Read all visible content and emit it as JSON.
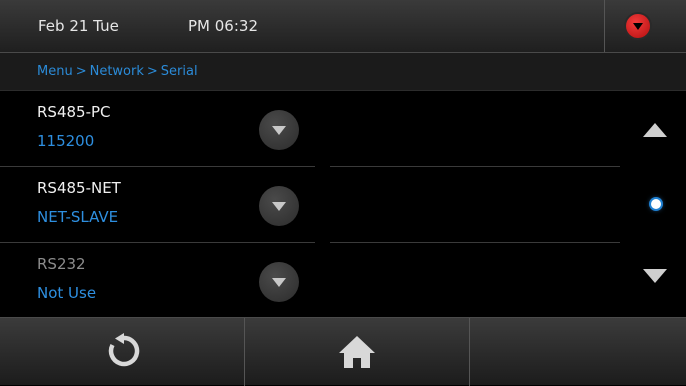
{
  "status_bar": {
    "date": "Feb 21 Tue",
    "time": "PM 06:32",
    "menu_icon": "red-dropdown-icon"
  },
  "breadcrumb": {
    "items": [
      "Menu",
      "Network",
      "Serial"
    ],
    "separator": ">"
  },
  "serial_list": [
    {
      "label": "RS485-PC",
      "value": "115200",
      "enabled": true
    },
    {
      "label": "RS485-NET",
      "value": "NET-SLAVE",
      "enabled": true
    },
    {
      "label": "RS232",
      "value": "Not Use",
      "enabled": false
    }
  ],
  "scroll": {
    "up_icon": "arrow-up-icon",
    "indicator": "scroll-position-dot",
    "down_icon": "arrow-down-icon"
  },
  "footer": {
    "buttons": [
      "refresh-icon",
      "home-icon",
      "empty"
    ]
  },
  "colors": {
    "accent_blue": "#2e8fe0",
    "alert_red": "#e02020",
    "background": "#000000"
  }
}
